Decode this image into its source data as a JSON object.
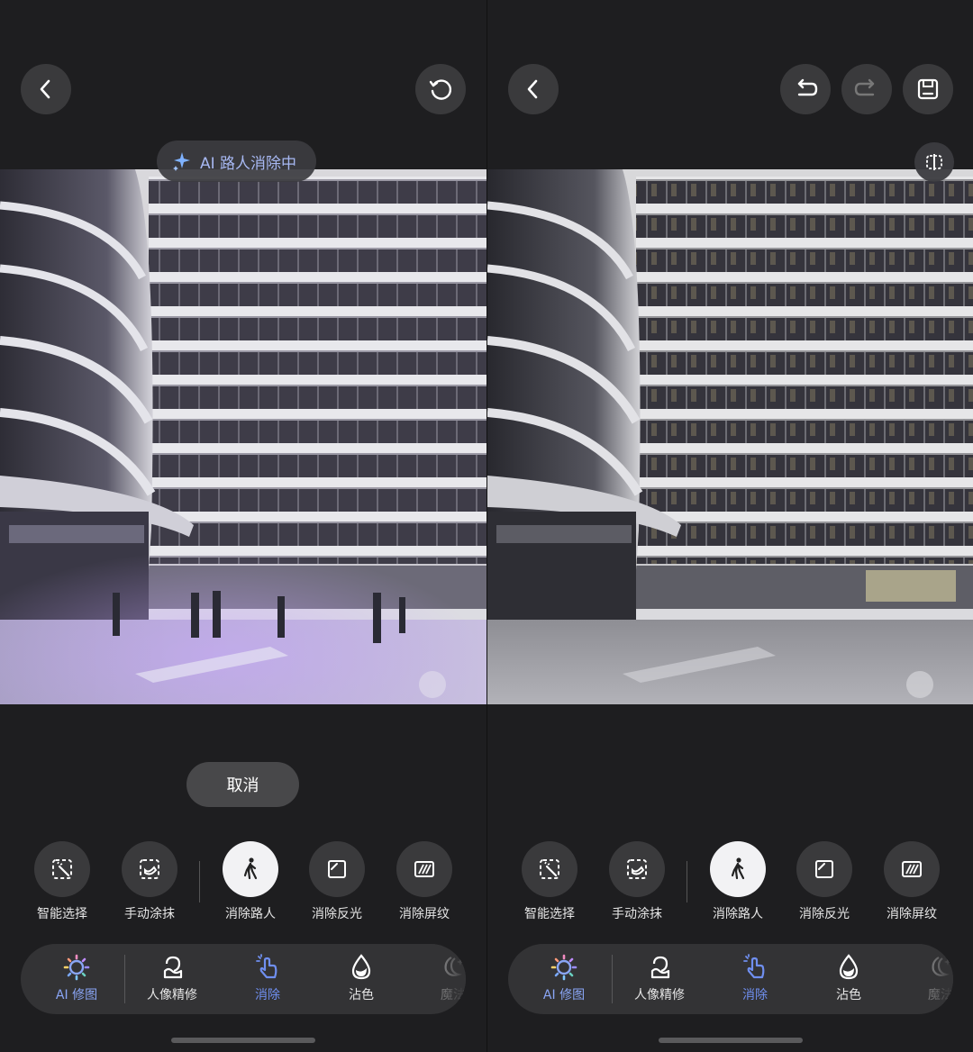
{
  "left": {
    "ai_status": "AI 路人消除中",
    "cancel_label": "取消",
    "tools": [
      {
        "label": "智能选择",
        "icon": "smart-select-icon"
      },
      {
        "label": "手动涂抹",
        "icon": "manual-brush-icon"
      },
      {
        "label": "消除路人",
        "icon": "walking-person-icon",
        "active": true
      },
      {
        "label": "消除反光",
        "icon": "remove-reflection-icon"
      },
      {
        "label": "消除屏纹",
        "icon": "remove-screen-pattern-icon"
      }
    ],
    "tabs": [
      {
        "label": "AI 修图",
        "icon": "ai-sparkle-icon"
      },
      {
        "label": "人像精修",
        "icon": "portrait-icon"
      },
      {
        "label": "消除",
        "icon": "erase-hand-icon",
        "active": true
      },
      {
        "label": "沾色",
        "icon": "color-drop-icon"
      },
      {
        "label": "魔法",
        "icon": "magic-icon"
      }
    ]
  },
  "right": {
    "tools": [
      {
        "label": "智能选择",
        "icon": "smart-select-icon"
      },
      {
        "label": "手动涂抹",
        "icon": "manual-brush-icon"
      },
      {
        "label": "消除路人",
        "icon": "walking-person-icon",
        "active": true
      },
      {
        "label": "消除反光",
        "icon": "remove-reflection-icon"
      },
      {
        "label": "消除屏纹",
        "icon": "remove-screen-pattern-icon"
      }
    ],
    "tabs": [
      {
        "label": "AI 修图",
        "icon": "ai-sparkle-icon"
      },
      {
        "label": "人像精修",
        "icon": "portrait-icon"
      },
      {
        "label": "消除",
        "icon": "erase-hand-icon",
        "active": true
      },
      {
        "label": "沾色",
        "icon": "color-drop-icon"
      },
      {
        "label": "魔法",
        "icon": "magic-icon"
      }
    ]
  },
  "colors": {
    "accent": "#6f8ff0",
    "ai_text": "#a7b8f2",
    "background": "#1e1e20",
    "button": "#3a3a3c"
  }
}
